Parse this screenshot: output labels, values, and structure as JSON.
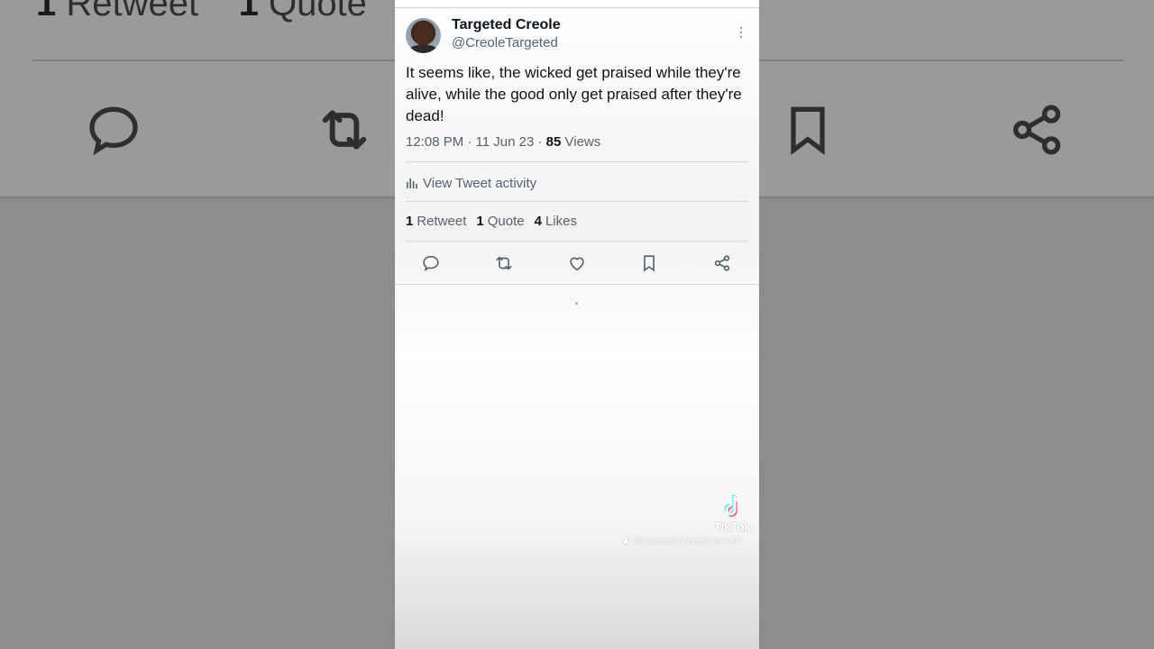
{
  "background": {
    "retweet_count": "1",
    "retweet_label": "Retweet",
    "quote_count": "1",
    "quote_label": "Quote"
  },
  "tweet": {
    "display_name": "Targeted Creole",
    "handle": "@CreoleTargeted",
    "text": "It seems like, the wicked get praised while they're alive, while the good only get praised after they're dead!",
    "time": "12:08 PM · 11 Jun 23 · ",
    "views_count": "85",
    "views_label": "Views",
    "activity_label": "View Tweet activity",
    "retweets_count": "1",
    "retweets_label": "Retweet",
    "quotes_count": "1",
    "quotes_label": "Quote",
    "likes_count": "4",
    "likes_label": "Likes"
  },
  "actions": [
    "reply-icon",
    "retweet-icon",
    "like-icon",
    "bookmark-icon",
    "share-icon"
  ],
  "watermark": {
    "brand": "TikTok",
    "username": "@targetedbythepsychworld"
  },
  "colors": {
    "primary_text": "#0f1419",
    "secondary_text": "#536471",
    "icon": "#536471"
  }
}
